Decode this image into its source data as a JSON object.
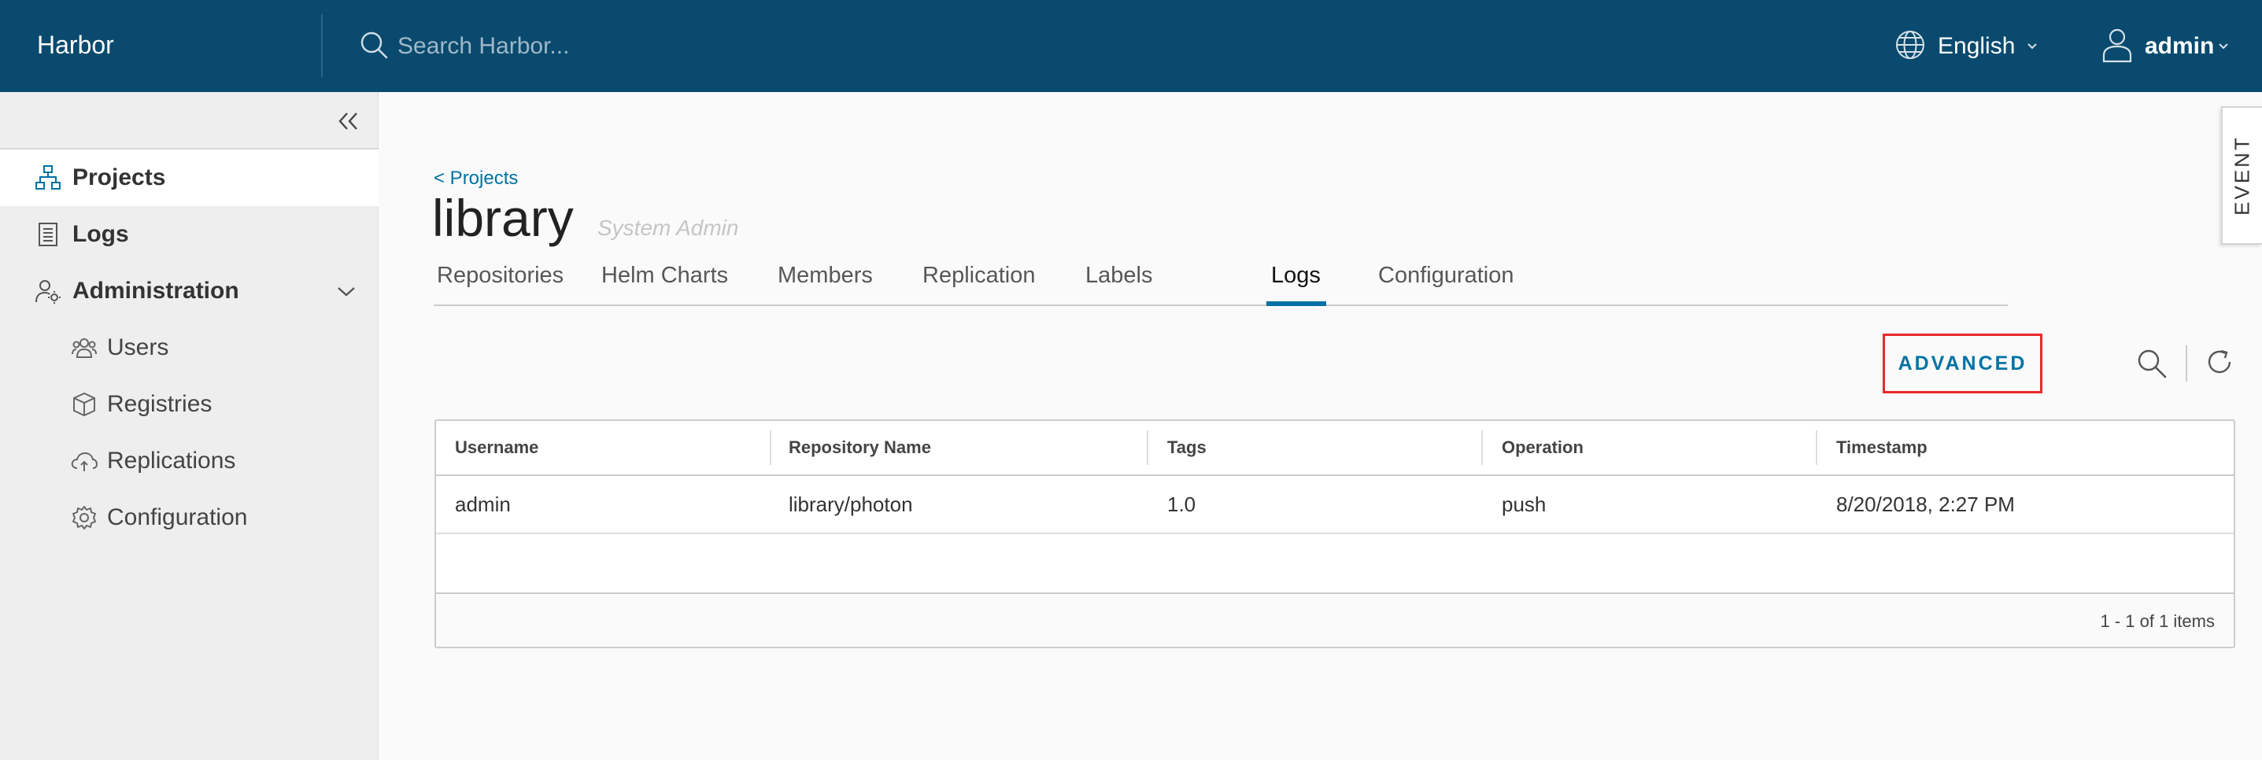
{
  "header": {
    "brand": "Harbor",
    "search_placeholder": "Search Harbor...",
    "language": "English",
    "user": "admin"
  },
  "sidebar": {
    "items": [
      {
        "label": "Projects",
        "icon": "projects-icon",
        "active": true
      },
      {
        "label": "Logs",
        "icon": "logs-icon"
      },
      {
        "label": "Administration",
        "icon": "administration-icon",
        "expanded": true
      },
      {
        "label": "Users",
        "icon": "users-icon"
      },
      {
        "label": "Registries",
        "icon": "registries-icon"
      },
      {
        "label": "Replications",
        "icon": "replications-icon"
      },
      {
        "label": "Configuration",
        "icon": "configuration-icon"
      }
    ]
  },
  "main": {
    "breadcrumb": "< Projects",
    "title": "library",
    "role": "System Admin",
    "tabs": [
      {
        "label": "Repositories"
      },
      {
        "label": "Helm Charts"
      },
      {
        "label": "Members"
      },
      {
        "label": "Replication"
      },
      {
        "label": "Labels"
      },
      {
        "label": "Logs",
        "active": true
      },
      {
        "label": "Configuration"
      }
    ],
    "toolbar": {
      "advanced_label": "ADVANCED"
    },
    "grid": {
      "columns": [
        "Username",
        "Repository Name",
        "Tags",
        "Operation",
        "Timestamp"
      ],
      "rows": [
        [
          "admin",
          "library/photon",
          "1.0",
          "push",
          "8/20/2018, 2:27 PM"
        ]
      ],
      "footer": "1 - 1 of 1 items"
    }
  },
  "event_tab": "EVENT",
  "colors": {
    "header_bg": "#094a6e",
    "accent": "#0072a3",
    "highlight_border": "#e8292a",
    "sidebar_bg": "#eeeeee"
  }
}
